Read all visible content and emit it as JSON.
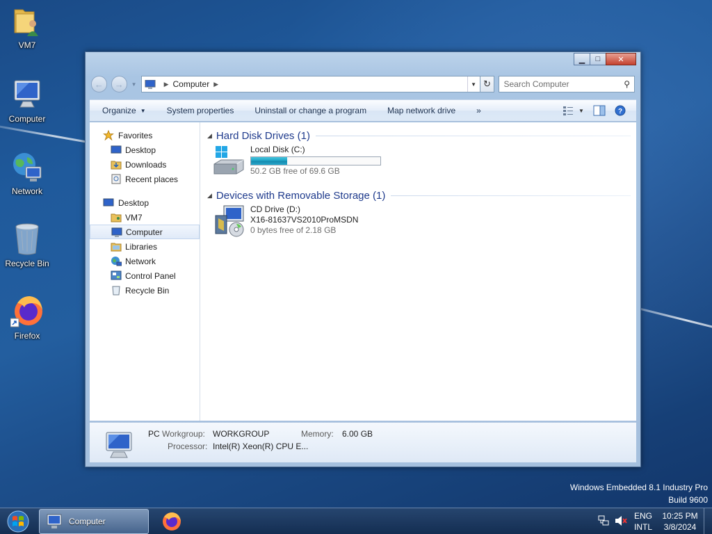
{
  "desktop": {
    "icons": [
      {
        "label": "VM7",
        "icon": "user-folder-icon"
      },
      {
        "label": "Computer",
        "icon": "computer-icon"
      },
      {
        "label": "Network",
        "icon": "network-globe-icon"
      },
      {
        "label": "Recycle Bin",
        "icon": "recycle-bin-icon"
      },
      {
        "label": "Firefox",
        "icon": "firefox-icon"
      }
    ],
    "watermark": {
      "line1": "Windows Embedded 8.1 Industry Pro",
      "line2": "Build 9600"
    }
  },
  "window": {
    "title": "Computer",
    "caption_buttons": [
      "minimize",
      "maximize",
      "close"
    ],
    "address": {
      "crumb": "Computer"
    },
    "search": {
      "placeholder": "Search Computer"
    },
    "toolbar": {
      "organize": "Organize",
      "system_properties": "System properties",
      "uninstall": "Uninstall or change a program",
      "map_drive": "Map network drive",
      "more": "»"
    },
    "nav": {
      "favorites": {
        "label": "Favorites",
        "items": [
          "Desktop",
          "Downloads",
          "Recent places"
        ]
      },
      "desktop": {
        "label": "Desktop",
        "items": [
          "VM7",
          "Computer",
          "Libraries",
          "Network",
          "Control Panel",
          "Recycle Bin"
        ]
      },
      "selected": "Computer"
    },
    "groups": {
      "hdd": {
        "title": "Hard Disk Drives (1)",
        "drive": {
          "name": "Local Disk (C:)",
          "free_text": "50.2 GB free of 69.6 GB",
          "used_fraction": 0.279
        }
      },
      "removable": {
        "title": "Devices with Removable Storage (1)",
        "drive": {
          "name": "CD Drive (D:)",
          "label": "X16-81637VS2010ProMSDN",
          "free_text": "0 bytes free of 2.18 GB"
        }
      }
    },
    "details": {
      "name": "PC",
      "workgroup_label": "Workgroup:",
      "workgroup": "WORKGROUP",
      "memory_label": "Memory:",
      "memory": "6.00 GB",
      "processor_label": "Processor:",
      "processor": "Intel(R) Xeon(R) CPU E..."
    }
  },
  "taskbar": {
    "task_label": "Computer",
    "lang": {
      "line1": "ENG",
      "line2": "INTL"
    },
    "clock": {
      "time": "10:25 PM",
      "date": "3/8/2024"
    }
  }
}
